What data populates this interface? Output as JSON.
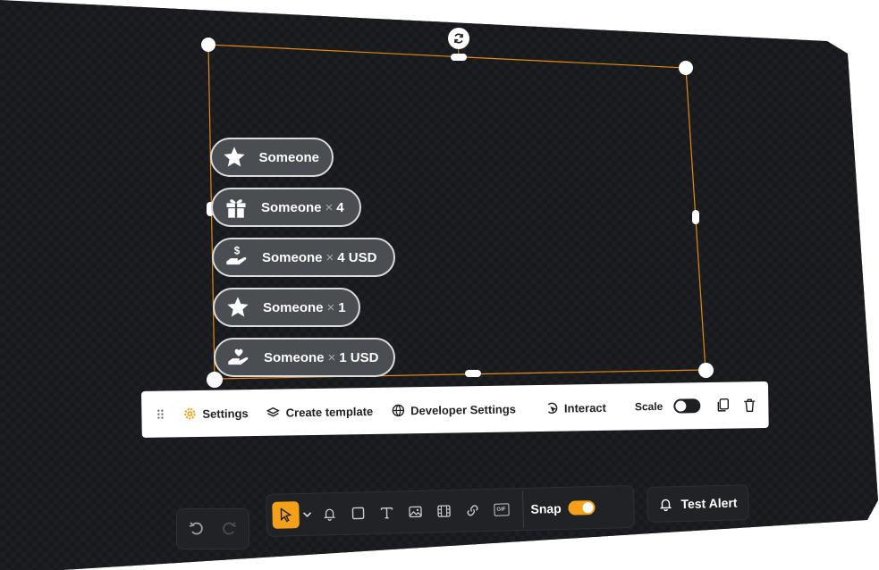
{
  "alerts": [
    {
      "icon": "star-icon",
      "name": "Someone",
      "amount": ""
    },
    {
      "icon": "gift-icon",
      "name": "Someone",
      "amount": "4"
    },
    {
      "icon": "hand-dollar-icon",
      "name": "Someone",
      "amount": "4 USD"
    },
    {
      "icon": "star-icon",
      "name": "Someone",
      "amount": "1"
    },
    {
      "icon": "hand-heart-icon",
      "name": "Someone",
      "amount": "1 USD"
    }
  ],
  "times_symbol": "×",
  "context_toolbar": {
    "settings": "Settings",
    "create_template": "Create template",
    "developer_settings": "Developer Settings",
    "interact": "Interact",
    "scale": "Scale",
    "scale_enabled": false
  },
  "bottom_toolbar": {
    "tools": [
      "select-icon",
      "bell-icon",
      "rectangle-icon",
      "text-icon",
      "image-icon",
      "video-icon",
      "link-icon",
      "gif-icon"
    ],
    "gif_label": "GIF",
    "snap_label": "Snap",
    "snap_enabled": true,
    "test_alert_label": "Test Alert"
  },
  "colors": {
    "accent": "#f4a019",
    "background": "#17191c",
    "pill_bg": "#4a4d52",
    "toolbar_bg": "#ffffff"
  }
}
